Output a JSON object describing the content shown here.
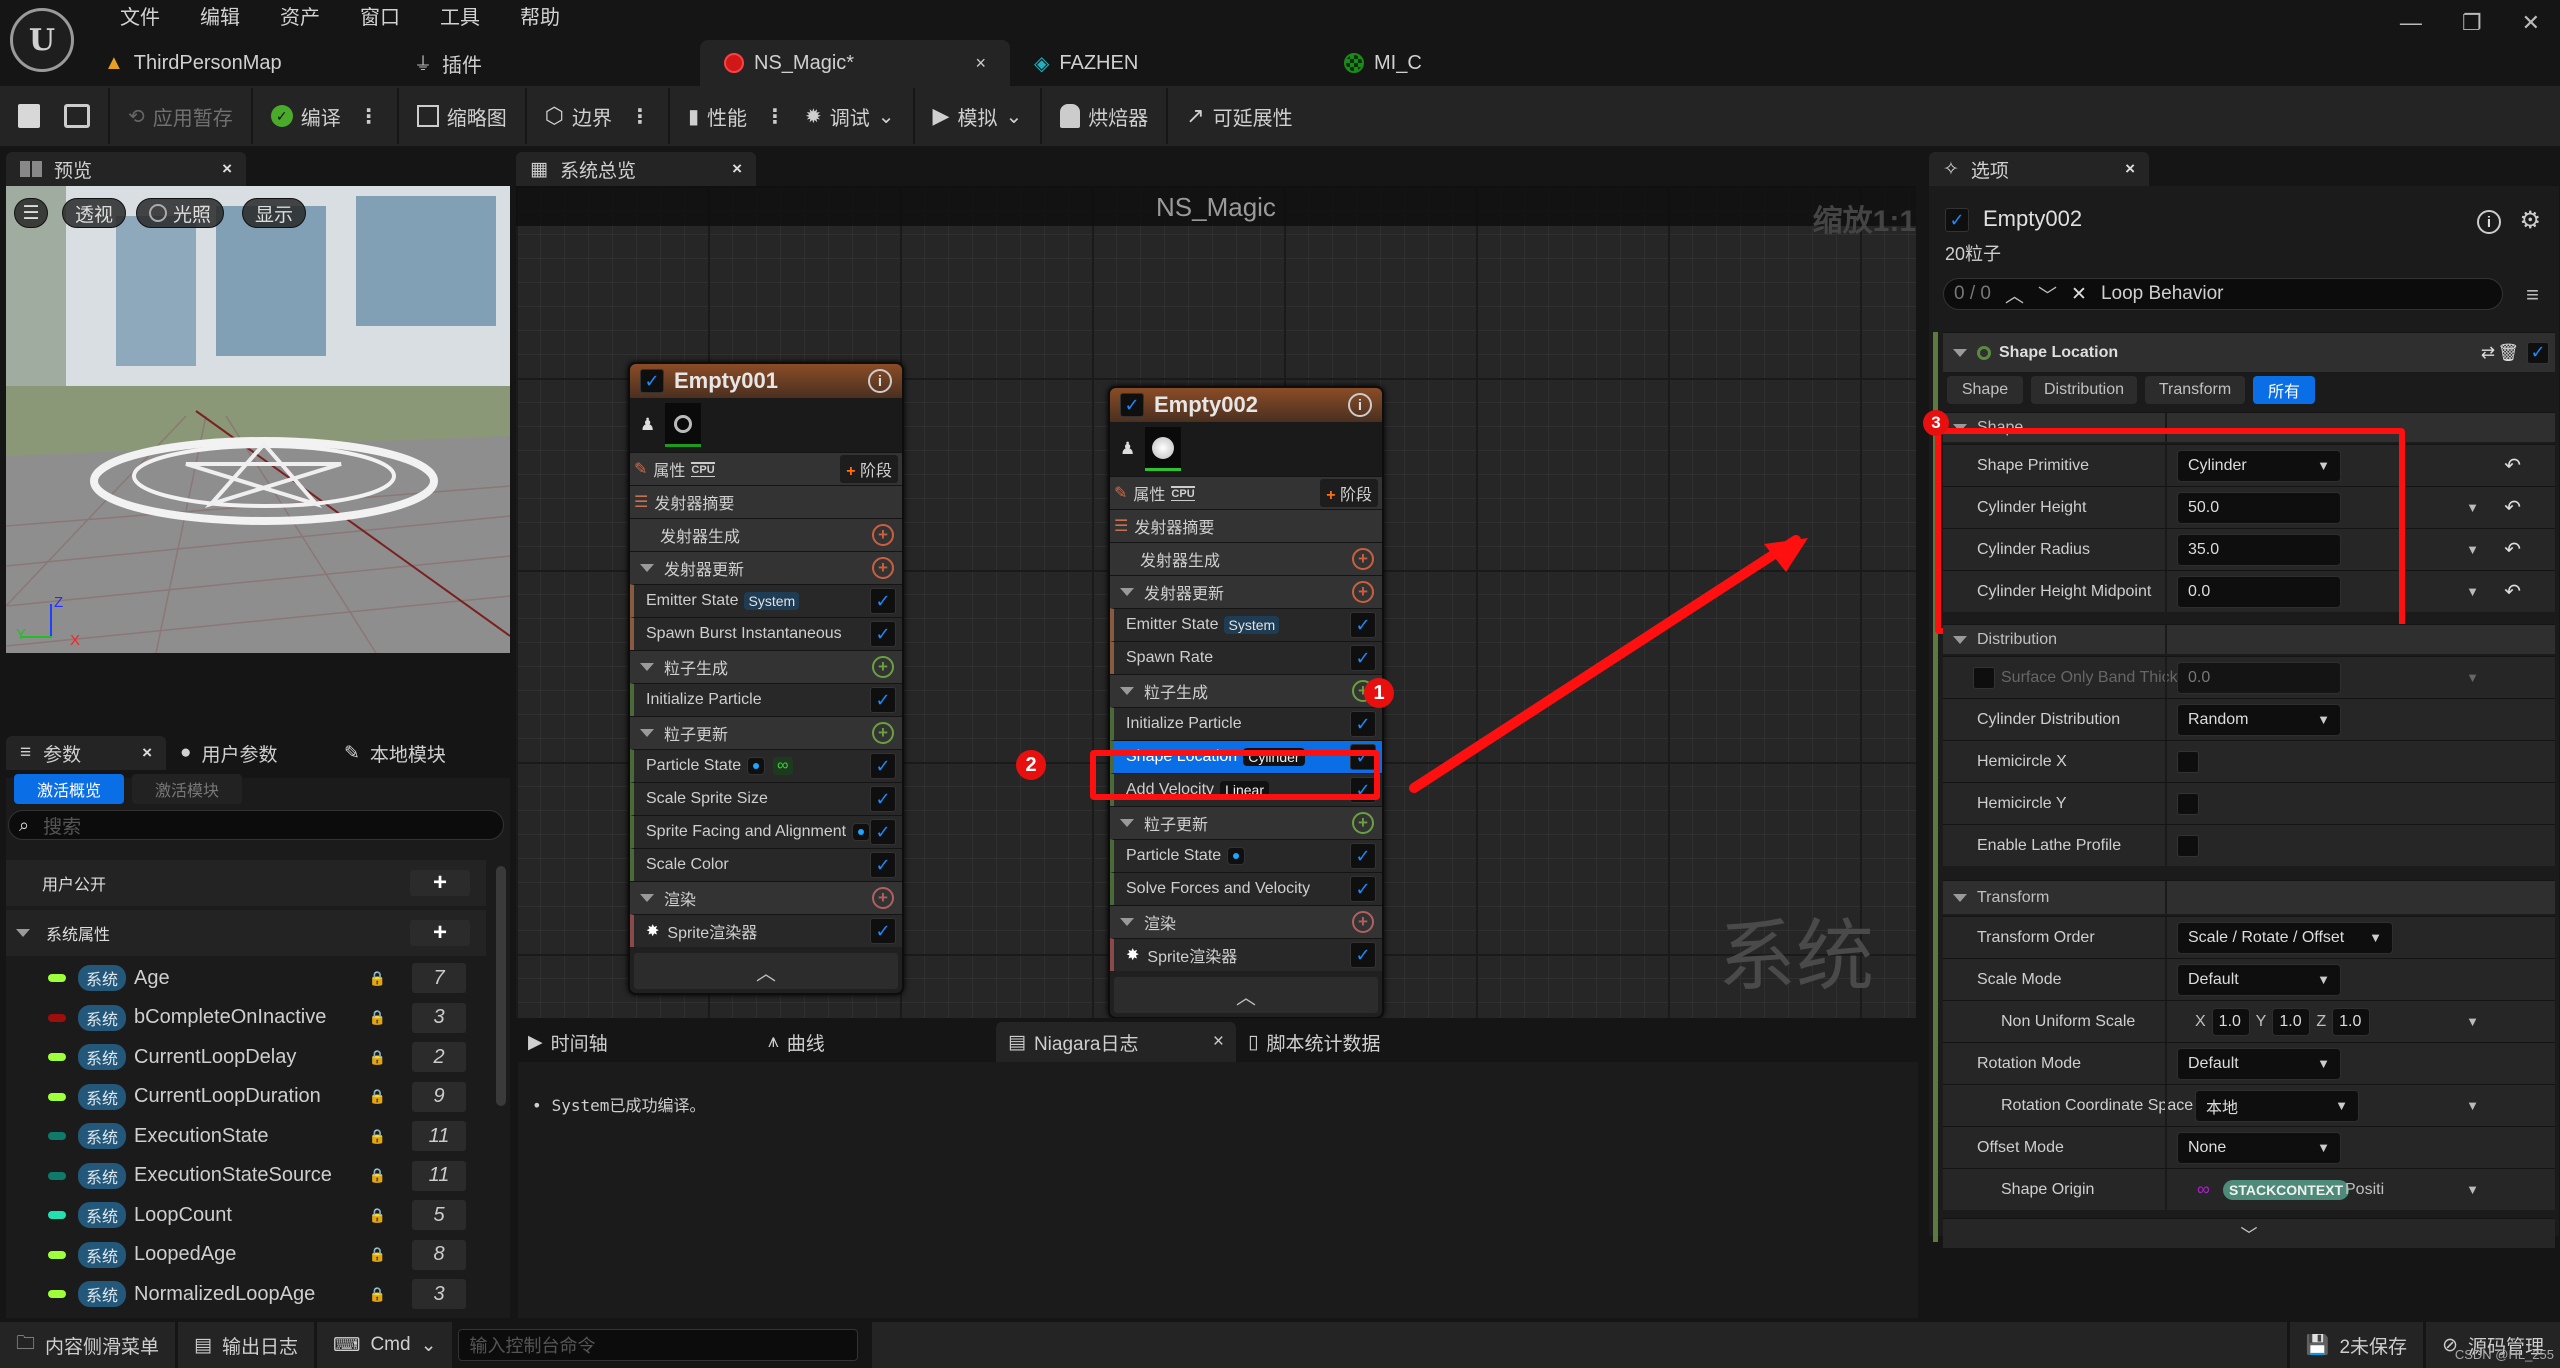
{
  "app": {
    "logo": "U",
    "menu": [
      "文件",
      "编辑",
      "资产",
      "窗口",
      "工具",
      "帮助"
    ],
    "window_controls": {
      "minimize": "—",
      "restore": "❐",
      "close": "✕"
    }
  },
  "doc_tabs": [
    {
      "label": "ThirdPersonMap",
      "icon": "level-icon",
      "color": "#e8a020",
      "active": false
    },
    {
      "label": "插件",
      "icon": "plugin-icon",
      "color": "#bbbbbb",
      "active": false
    },
    {
      "label": "NS_Magic*",
      "icon": "niagara-system-icon",
      "color": "#e02020",
      "active": true,
      "close": "×"
    },
    {
      "label": "FAZHEN",
      "icon": "texture-icon",
      "color": "#20b0c0",
      "active": false
    },
    {
      "label": "MI_C",
      "icon": "material-instance-icon",
      "color": "#1a8a1a",
      "active": false
    }
  ],
  "toolbar": {
    "save": "save-icon",
    "browse": "browse-icon",
    "apply": "应用暂存",
    "compile": "编译",
    "thumbnail": "缩略图",
    "bounds": "边界",
    "performance": "性能",
    "debug": "调试",
    "simulate": "模拟",
    "baker": "烘焙器",
    "scalability": "可延展性",
    "more": "⋮",
    "chevron": "⌄"
  },
  "preview": {
    "tab": "预览",
    "close": "×",
    "buttons": {
      "menu": "☰",
      "perspective": "透视",
      "lighting": "光照",
      "show": "显示"
    },
    "axes": {
      "z": "Z",
      "y": "Y",
      "x": "X"
    }
  },
  "params": {
    "tabs": [
      {
        "label": "参数",
        "close": "×"
      },
      {
        "label": "用户参数"
      },
      {
        "label": "本地模块"
      }
    ],
    "subtabs": {
      "active": "激活概览",
      "inactive": "激活模块"
    },
    "search_placeholder": "搜索",
    "user_exposed": "用户公开",
    "system_attrs": "系统属性",
    "add": "+",
    "badge": "系统",
    "attributes": [
      {
        "name": "Age",
        "count": "7",
        "color": "#9eff3a"
      },
      {
        "name": "bCompleteOnInactive",
        "count": "3",
        "color": "#a00d0d"
      },
      {
        "name": "CurrentLoopDelay",
        "count": "2",
        "color": "#9eff3a"
      },
      {
        "name": "CurrentLoopDuration",
        "count": "9",
        "color": "#9eff3a"
      },
      {
        "name": "ExecutionState",
        "count": "11",
        "color": "#0d7a6a"
      },
      {
        "name": "ExecutionStateSource",
        "count": "11",
        "color": "#0d7a6a"
      },
      {
        "name": "LoopCount",
        "count": "5",
        "color": "#22e0b0"
      },
      {
        "name": "LoopedAge",
        "count": "8",
        "color": "#9eff3a"
      },
      {
        "name": "NormalizedLoopAge",
        "count": "3",
        "color": "#9eff3a"
      }
    ]
  },
  "graph": {
    "tab": "系统总览",
    "close": "×",
    "title": "NS_Magic",
    "zoom": "缩放1:1",
    "watermark": "系统",
    "nodes": [
      {
        "name": "Empty001",
        "properties": "属性",
        "cpu": "CPU",
        "stage": "阶段",
        "summary": "发射器摘要",
        "spawn": "发射器生成",
        "update": "发射器更新",
        "emitter_modules": [
          {
            "label": "Emitter State",
            "tag": "System"
          },
          {
            "label": "Spawn Burst Instantaneous"
          }
        ],
        "particle_spawn": "粒子生成",
        "spawn_modules": [
          {
            "label": "Initialize Particle"
          }
        ],
        "particle_update": "粒子更新",
        "update_modules": [
          {
            "label": "Particle State",
            "dot": true,
            "loop": "∞"
          },
          {
            "label": "Scale Sprite Size"
          },
          {
            "label": "Sprite Facing and Alignment",
            "dot": true
          },
          {
            "label": "Scale Color"
          }
        ],
        "render": "渲染",
        "renderer": "Sprite渲染器"
      },
      {
        "name": "Empty002",
        "properties": "属性",
        "cpu": "CPU",
        "stage": "阶段",
        "summary": "发射器摘要",
        "spawn": "发射器生成",
        "update": "发射器更新",
        "emitter_modules": [
          {
            "label": "Emitter State",
            "tag": "System"
          },
          {
            "label": "Spawn Rate"
          }
        ],
        "particle_spawn": "粒子生成",
        "spawn_modules": [
          {
            "label": "Initialize Particle"
          },
          {
            "label": "Shape Location",
            "tag": "Cylinder",
            "selected": true
          },
          {
            "label": "Add Velocity",
            "tag": "Linear"
          }
        ],
        "particle_update": "粒子更新",
        "update_modules": [
          {
            "label": "Particle State",
            "dot": true
          },
          {
            "label": "Solve Forces and Velocity"
          }
        ],
        "render": "渲染",
        "renderer": "Sprite渲染器"
      }
    ],
    "markers": [
      "1",
      "2",
      "3"
    ]
  },
  "log": {
    "tabs": [
      {
        "label": "时间轴"
      },
      {
        "label": "曲线"
      },
      {
        "label": "Niagara日志",
        "active": true,
        "close": "×"
      },
      {
        "label": "脚本统计数据"
      }
    ],
    "messages": [
      "System已成功编译。"
    ]
  },
  "details": {
    "tab": "选项",
    "close": "×",
    "emitter": "Empty002",
    "particles": "20粒子",
    "search": {
      "count": "0 / 0",
      "value": "Loop Behavior"
    },
    "module": "Shape Location",
    "filters": [
      "Shape",
      "Distribution",
      "Transform",
      "所有"
    ],
    "active_filter": "所有",
    "sections": {
      "shape": "Shape",
      "distribution": "Distribution",
      "transform": "Transform"
    },
    "shape_props": [
      {
        "label": "Shape Primitive",
        "value": "Cylinder",
        "type": "dropdown"
      },
      {
        "label": "Cylinder Height",
        "value": "50.0",
        "type": "number"
      },
      {
        "label": "Cylinder Radius",
        "value": "35.0",
        "type": "number"
      },
      {
        "label": "Cylinder Height Midpoint",
        "value": "0.0",
        "type": "number"
      }
    ],
    "distribution_props": [
      {
        "label": "Surface Only Band Thickne",
        "value": "0.0",
        "type": "number",
        "disabled": true
      },
      {
        "label": "Cylinder Distribution",
        "value": "Random",
        "type": "dropdown"
      },
      {
        "label": "Hemicircle X",
        "value": false,
        "type": "checkbox"
      },
      {
        "label": "Hemicircle Y",
        "value": false,
        "type": "checkbox"
      },
      {
        "label": "Enable Lathe Profile",
        "value": false,
        "type": "checkbox"
      }
    ],
    "transform_props": {
      "transform_order": {
        "label": "Transform Order",
        "value": "Scale / Rotate / Offset"
      },
      "scale_mode": {
        "label": "Scale Mode",
        "value": "Default"
      },
      "non_uniform_scale": {
        "label": "Non Uniform Scale",
        "x": "1.0",
        "y": "1.0",
        "z": "1.0"
      },
      "rotation_mode": {
        "label": "Rotation Mode",
        "value": "Default"
      },
      "rotation_space": {
        "label": "Rotation Coordinate Space",
        "value": "本地"
      },
      "offset_mode": {
        "label": "Offset Mode",
        "value": "None"
      },
      "shape_origin": {
        "label": "Shape Origin",
        "badge": "STACKCONTEXT",
        "value": "Positi"
      }
    }
  },
  "statusbar": {
    "content_drawer": "内容侧滑菜单",
    "output_log": "输出日志",
    "cmd": "Cmd",
    "console_placeholder": "输入控制台命令",
    "unsaved": "2未保存",
    "source_control": "源码管理",
    "watermark": "CSDN @HL_255"
  }
}
